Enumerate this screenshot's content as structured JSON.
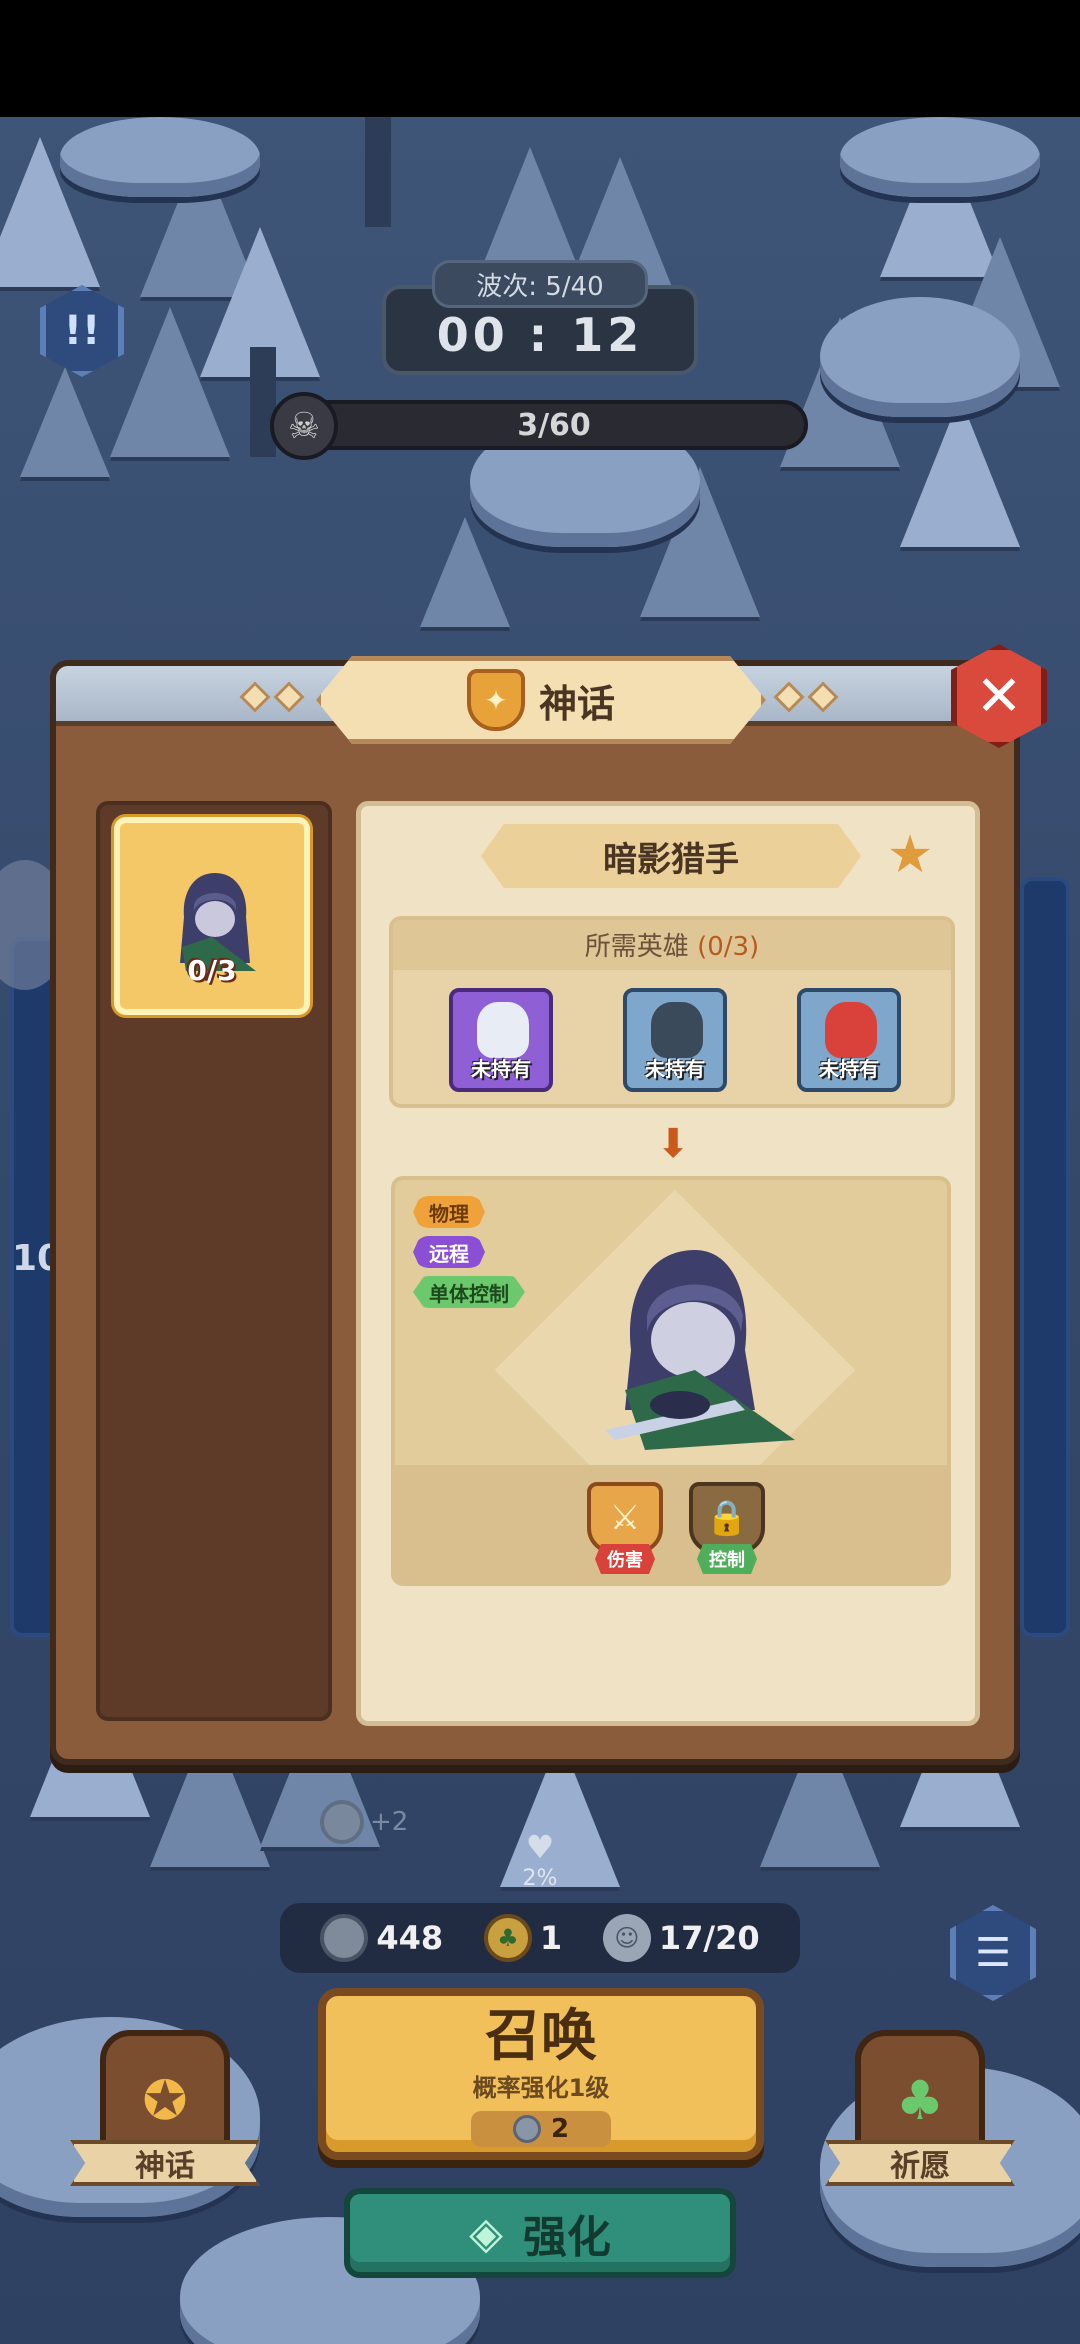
{
  "hud": {
    "wave": "波次: 5/40",
    "timer": "00 : 12",
    "kills": "3/60",
    "edge_number": "10"
  },
  "dialog": {
    "title": "神话",
    "left_card_count": "0/3",
    "hero_name": "暗影猎手",
    "required_label": "所需英雄",
    "required_count": "(0/3)",
    "required_heroes": [
      {
        "label": "未持有",
        "color": "#8f5fd6"
      },
      {
        "label": "未持有",
        "color": "#7fa7cc"
      },
      {
        "label": "未持有",
        "color": "#7fa7cc"
      }
    ],
    "tags": [
      "物理",
      "远程",
      "单体控制"
    ],
    "skills": [
      {
        "label": "伤害",
        "icon": "fire-sword-icon"
      },
      {
        "label": "控制",
        "icon": "lock-icon"
      }
    ]
  },
  "bottom": {
    "plus_coin": "+2",
    "luck": "2%",
    "coins": "448",
    "clover": "1",
    "units": "17/20",
    "summon_title": "召唤",
    "summon_sub": "概率强化1级",
    "summon_cost": "2",
    "enhance": "强化",
    "left_btn": "神话",
    "right_btn": "祈愿"
  },
  "colors": {
    "accent_gold": "#f2c05a",
    "enhance_green": "#2f8f7a",
    "close_red": "#d9493c"
  }
}
